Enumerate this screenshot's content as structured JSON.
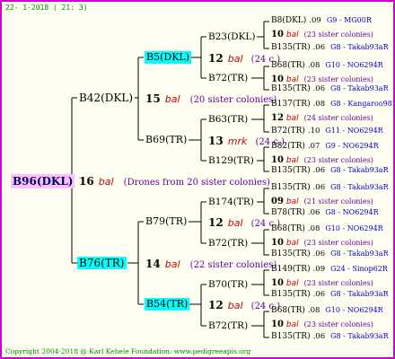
{
  "header": {
    "date": "22-  1-2018 ( 21:  3)"
  },
  "footer": {
    "text": "Copyright 2004-2018 @ Karl Kehele Foundation.   www.pedigreeapis.org"
  },
  "colors": {
    "border": "#cc00cc",
    "background": "#fffff2",
    "highlight": "#00ffff",
    "root_bg": "#ffc0ff",
    "bal": "#cc0000",
    "sisters": "#660099",
    "breeder": "#0000cc"
  },
  "root": {
    "name": "B96(DKL)",
    "count": "16",
    "origin": "bal",
    "sisters": "(Drones from 20 sister colonies)"
  },
  "sire": {
    "name": "B42(DKL)",
    "count": "15",
    "origin": "bal",
    "sisters": "(20 sister colonies)"
  },
  "dam": {
    "name": "B76(TR)",
    "count": "14",
    "origin": "bal",
    "sisters": "(22 sister colonies)"
  },
  "ss": {
    "name": "B5(DKL)",
    "count": "12",
    "origin": "bal",
    "sisters": "(24 c.)"
  },
  "sd": {
    "name": "B69(TR)",
    "count": "13",
    "origin": "mrk",
    "sisters": "(24 c.)"
  },
  "ds": {
    "name": "B79(TR)",
    "count": "12",
    "origin": "bal",
    "sisters": "(24 c.)"
  },
  "dd": {
    "name": "B54(TR)",
    "count": "12",
    "origin": "bal",
    "sisters": "(24 c.)"
  },
  "g3": [
    {
      "name": "B23(DKL)"
    },
    {
      "name": "B72(TR)"
    },
    {
      "name": "B63(TR)"
    },
    {
      "name": "B129(TR)"
    },
    {
      "name": "B174(TR)"
    },
    {
      "name": "B72(TR)"
    },
    {
      "name": "B70(TR)"
    },
    {
      "name": "B72(TR)"
    }
  ],
  "g4": [
    {
      "name": "B8(DKL)",
      "year": ".09",
      "breeder": "G9 - MG00R"
    },
    {
      "name": "10",
      "origin": "bal",
      "sisters": "(23 sister colonies)"
    },
    {
      "name": "B135(TR)",
      "year": ".06",
      "breeder": "G8 - Takab93aR"
    },
    {
      "name": "B68(TR)",
      "year": ".08",
      "breeder": "G10 - NO6294R"
    },
    {
      "name": "10",
      "origin": "bal",
      "sisters": "(23 sister colonies)"
    },
    {
      "name": "B135(TR)",
      "year": ".06",
      "breeder": "G8 - Takab93aR"
    },
    {
      "name": "B137(TR)",
      "year": ".08",
      "breeder": "G8 - Kangaroo98R"
    },
    {
      "name": "12",
      "origin": "bal",
      "sisters": "(24 sister colonies)"
    },
    {
      "name": "B72(TR)",
      "year": ".10",
      "breeder": "G11 - NO6294R"
    },
    {
      "name": "B82(TR)",
      "year": ".07",
      "breeder": "G9 - NO6294R"
    },
    {
      "name": "10",
      "origin": "bal",
      "sisters": "(23 sister colonies)"
    },
    {
      "name": "B135(TR)",
      "year": ".06",
      "breeder": "G8 - Takab93aR"
    },
    {
      "name": "B135(TR)",
      "year": ".06",
      "breeder": "G8 - Takab93aR"
    },
    {
      "name": "09",
      "origin": "bal",
      "sisters": "(21 sister colonies)"
    },
    {
      "name": "B78(TR)",
      "year": ".06",
      "breeder": "G8 - NO6294R"
    },
    {
      "name": "B68(TR)",
      "year": ".08",
      "breeder": "G10 - NO6294R"
    },
    {
      "name": "10",
      "origin": "bal",
      "sisters": "(23 sister colonies)"
    },
    {
      "name": "B135(TR)",
      "year": ".06",
      "breeder": "G8 - Takab93aR"
    },
    {
      "name": "B149(TR)",
      "year": ".09",
      "breeder": "G24 - Sinop62R"
    },
    {
      "name": "10",
      "origin": "bal",
      "sisters": "(23 sister colonies)"
    },
    {
      "name": "B135(TR)",
      "year": ".06",
      "breeder": "G8 - Takab93aR"
    },
    {
      "name": "B68(TR)",
      "year": ".08",
      "breeder": "G10 - NO6294R"
    },
    {
      "name": "10",
      "origin": "bal",
      "sisters": "(23 sister colonies)"
    },
    {
      "name": "B135(TR)",
      "year": ".06",
      "breeder": "G8 - Takab93aR"
    }
  ]
}
